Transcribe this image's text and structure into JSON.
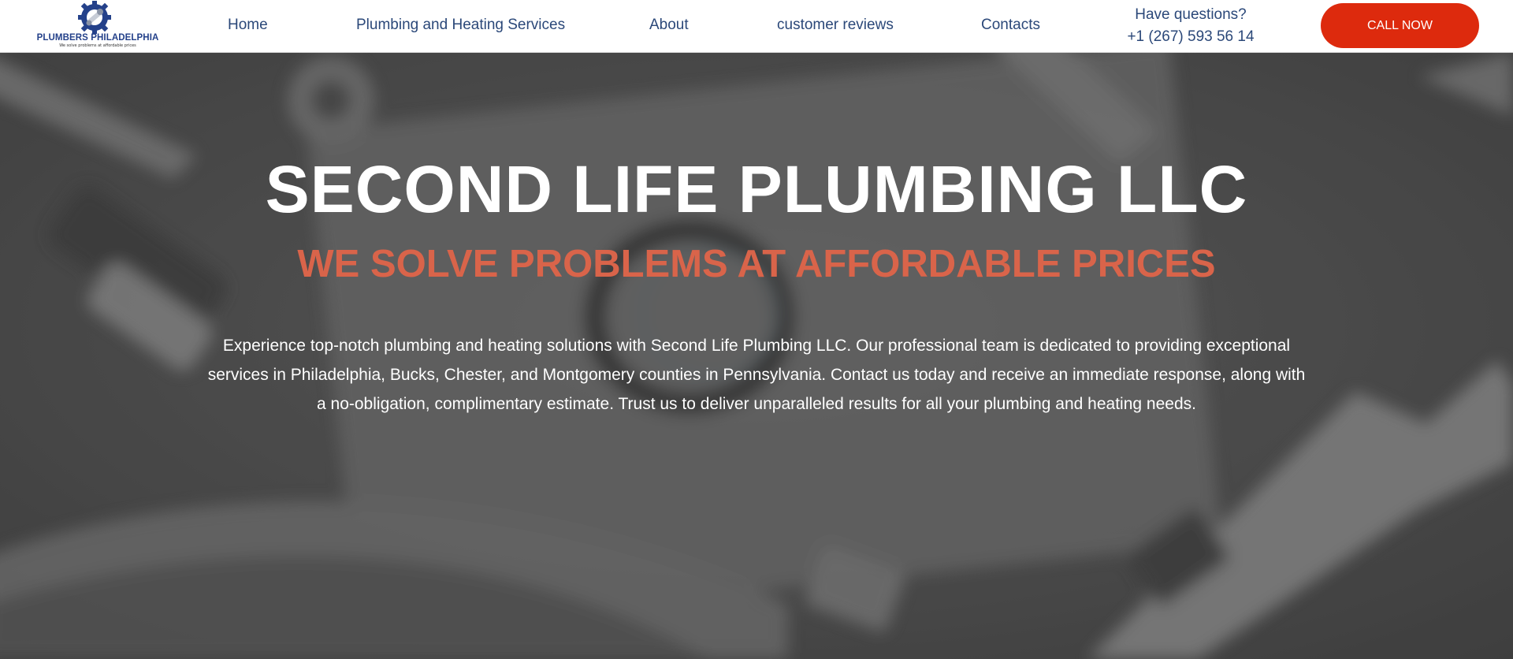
{
  "header": {
    "logo": {
      "name": "PLUMBERS PHILADELPHIA",
      "tagline": "We solve problems at affordable prices",
      "icon": "wrench-gear-icon"
    },
    "nav": [
      {
        "label": "Home"
      },
      {
        "label": "Plumbing and Heating Services"
      },
      {
        "label": "About"
      },
      {
        "label": "customer reviews"
      },
      {
        "label": "Contacts"
      }
    ],
    "contact": {
      "question": "Have questions?",
      "phone": "+1 (267) 593 56 14"
    },
    "cta_label": "CALL NOW"
  },
  "hero": {
    "title": "SECOND LIFE PLUMBING LLC",
    "subtitle": "WE SOLVE PROBLEMS AT AFFORDABLE PRICES",
    "description": "Experience top-notch plumbing and heating solutions with Second Life Plumbing LLC. Our professional team is dedicated to providing exceptional services in Philadelphia, Bucks, Chester, and Montgomery counties in Pennsylvania. Contact us today and receive an immediate response, along with a no-obligation, complimentary estimate. Trust us to deliver unparalleled results for all your plumbing and heating needs."
  },
  "colors": {
    "nav_text": "#2b4879",
    "brand_navy": "#24418a",
    "cta_red": "#dd2a0d",
    "subtitle_orange": "#d9644a",
    "hero_overlay": "#5a5a5a"
  }
}
